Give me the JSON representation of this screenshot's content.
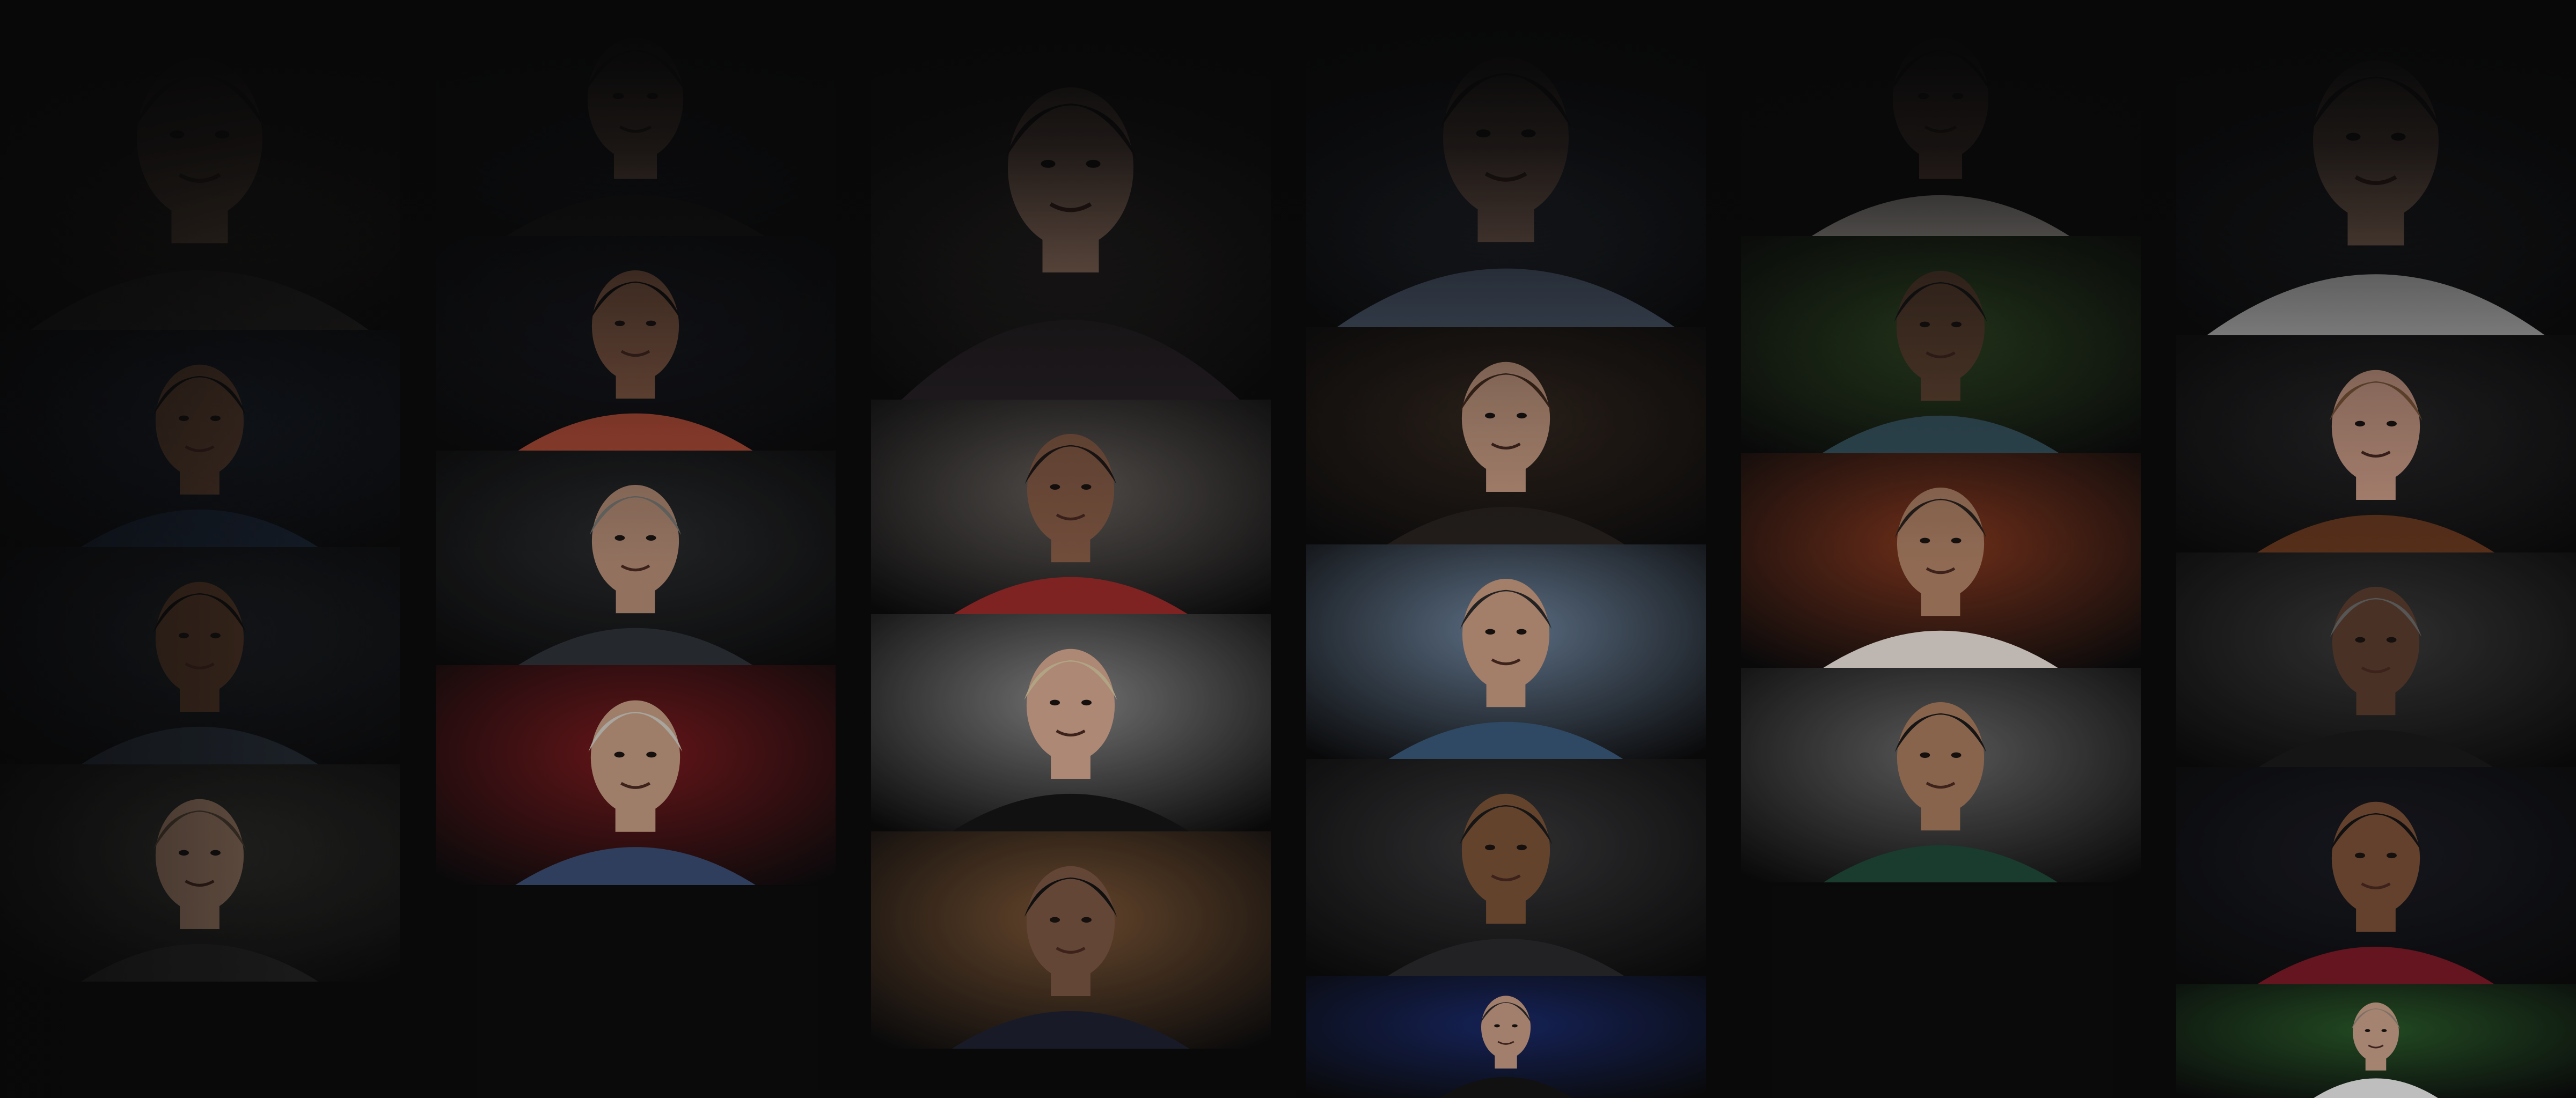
{
  "page": {
    "description_title": ""
  },
  "columns": [
    {
      "tiles": [
        {
          "name": "instructor-tile-woman-curly-hair",
          "bg": "#3a3128",
          "skin": "#8a6a52",
          "hair": "#3b2a1f",
          "cloth": "#2a2826"
        },
        {
          "name": "instructor-tile-man-suit-smiling",
          "bg": "#1c2430",
          "skin": "#6b4a36",
          "hair": "#141414",
          "cloth": "#1d2a3c"
        },
        {
          "name": "instructor-tile-man-dj-headphones",
          "bg": "#20252b",
          "skin": "#5e3f2c",
          "hair": "#121212",
          "cloth": "#2c3540"
        },
        {
          "name": "instructor-tile-man-glasses",
          "bg": "#3a3a36",
          "skin": "#b08a72",
          "hair": "#5a4a3a",
          "cloth": "#2a2a2a"
        }
      ]
    },
    {
      "tiles": [
        {
          "name": "instructor-tile-man-beard-closeup",
          "bg": "#22262c",
          "skin": "#a07a62",
          "hair": "#2b2620",
          "cloth": "#1a1a1a"
        },
        {
          "name": "instructor-tile-woman-laughing-colorful",
          "bg": "#191b22",
          "skin": "#8a5e48",
          "hair": "#141212",
          "cloth": "#b8503a"
        },
        {
          "name": "instructor-tile-man-bald-grey-beard",
          "bg": "#2a2c2e",
          "skin": "#b28a74",
          "hair": "#7a7a76",
          "cloth": "#2e3238"
        },
        {
          "name": "instructor-tile-man-theater-seats",
          "bg": "#7a1a1e",
          "skin": "#c29a80",
          "hair": "#cfcac2",
          "cloth": "#3a4c72"
        }
      ]
    },
    {
      "tiles": [
        {
          "name": "instructor-tile-woman-glasses-smiling",
          "bg": "#3a3430",
          "skin": "#c79a82",
          "hair": "#2a1e18",
          "cloth": "#2a2428"
        },
        {
          "name": "instructor-tile-woman-red-dress-plants",
          "bg": "#6a6460",
          "skin": "#8a5e48",
          "hair": "#1e1a18",
          "cloth": "#9a2a2a"
        },
        {
          "name": "instructor-tile-man-blond-black-tee",
          "bg": "#8a8a8a",
          "skin": "#d3a68e",
          "hair": "#d8c8a2",
          "cloth": "#151515"
        },
        {
          "name": "instructor-tile-man-mural-cane",
          "bg": "#7c5636",
          "skin": "#7a5644",
          "hair": "#141414",
          "cloth": "#1e2230"
        }
      ]
    },
    {
      "tiles": [
        {
          "name": "instructor-tile-man-plaid-shirt",
          "bg": "#3a4656",
          "skin": "#a88270",
          "hair": "#2a2420",
          "cloth": "#5a6a82"
        },
        {
          "name": "instructor-tile-woman-brunette-smiling",
          "bg": "#3a2c22",
          "skin": "#d3a48a",
          "hair": "#4a2e1e",
          "cloth": "#2a2420"
        },
        {
          "name": "instructor-tile-man-mountains-camera",
          "bg": "#6f86a0",
          "skin": "#c79a80",
          "hair": "#2a2a2a",
          "cloth": "#3a5a7a"
        },
        {
          "name": "instructor-tile-man-bold-glasses",
          "bg": "#3a3a3c",
          "skin": "#7a5238",
          "hair": "#1a1a1a",
          "cloth": "#2a2a2c"
        },
        {
          "name": "instructor-tile-dj-stage-lights",
          "bg": "#1a2a6a",
          "skin": "#c69c84",
          "hair": "#2a2a2a",
          "cloth": "#151515"
        }
      ]
    },
    {
      "tiles": [
        {
          "name": "instructor-tile-ballet-dancer",
          "bg": "#1a1818",
          "skin": "#8a6452",
          "hair": "#1a1616",
          "cloth": "#d8d0c8"
        },
        {
          "name": "instructor-tile-man-tropical-garden",
          "bg": "#3a5a2a",
          "skin": "#6a4a36",
          "hair": "#1a1a1a",
          "cloth": "#3a5a66"
        },
        {
          "name": "instructor-tile-man-warm-background",
          "bg": "#8a3a20",
          "skin": "#b08266",
          "hair": "#2a2220",
          "cloth": "#e8e0d8"
        },
        {
          "name": "instructor-tile-man-black-hat-mustache",
          "bg": "#6a6a6a",
          "skin": "#a87a5e",
          "hair": "#1a1a1a",
          "cloth": "#1f4a3a"
        }
      ]
    },
    {
      "tiles": [
        {
          "name": "instructor-tile-man-bicycle",
          "bg": "#2a2e34",
          "skin": "#b08a72",
          "hair": "#2a2622",
          "cloth": "#e0e0e0"
        },
        {
          "name": "instructor-tile-woman-bob-sunglasses",
          "bg": "#2a2a2c",
          "skin": "#d6a48e",
          "hair": "#8a6040",
          "cloth": "#6a3a20"
        },
        {
          "name": "instructor-tile-man-flat-cap",
          "bg": "#3a3a3a",
          "skin": "#5a3e2e",
          "hair": "#6a6a6a",
          "cloth": "#1a1a1a"
        },
        {
          "name": "instructor-tile-woman-athlete",
          "bg": "#1a1c24",
          "skin": "#7a5038",
          "hair": "#141414",
          "cloth": "#7a1a26"
        },
        {
          "name": "instructor-tile-man-garden-trees",
          "bg": "#2a5a2a",
          "skin": "#c8a08a",
          "hair": "#9a8a7a",
          "cloth": "#e8e8e8"
        }
      ]
    }
  ]
}
